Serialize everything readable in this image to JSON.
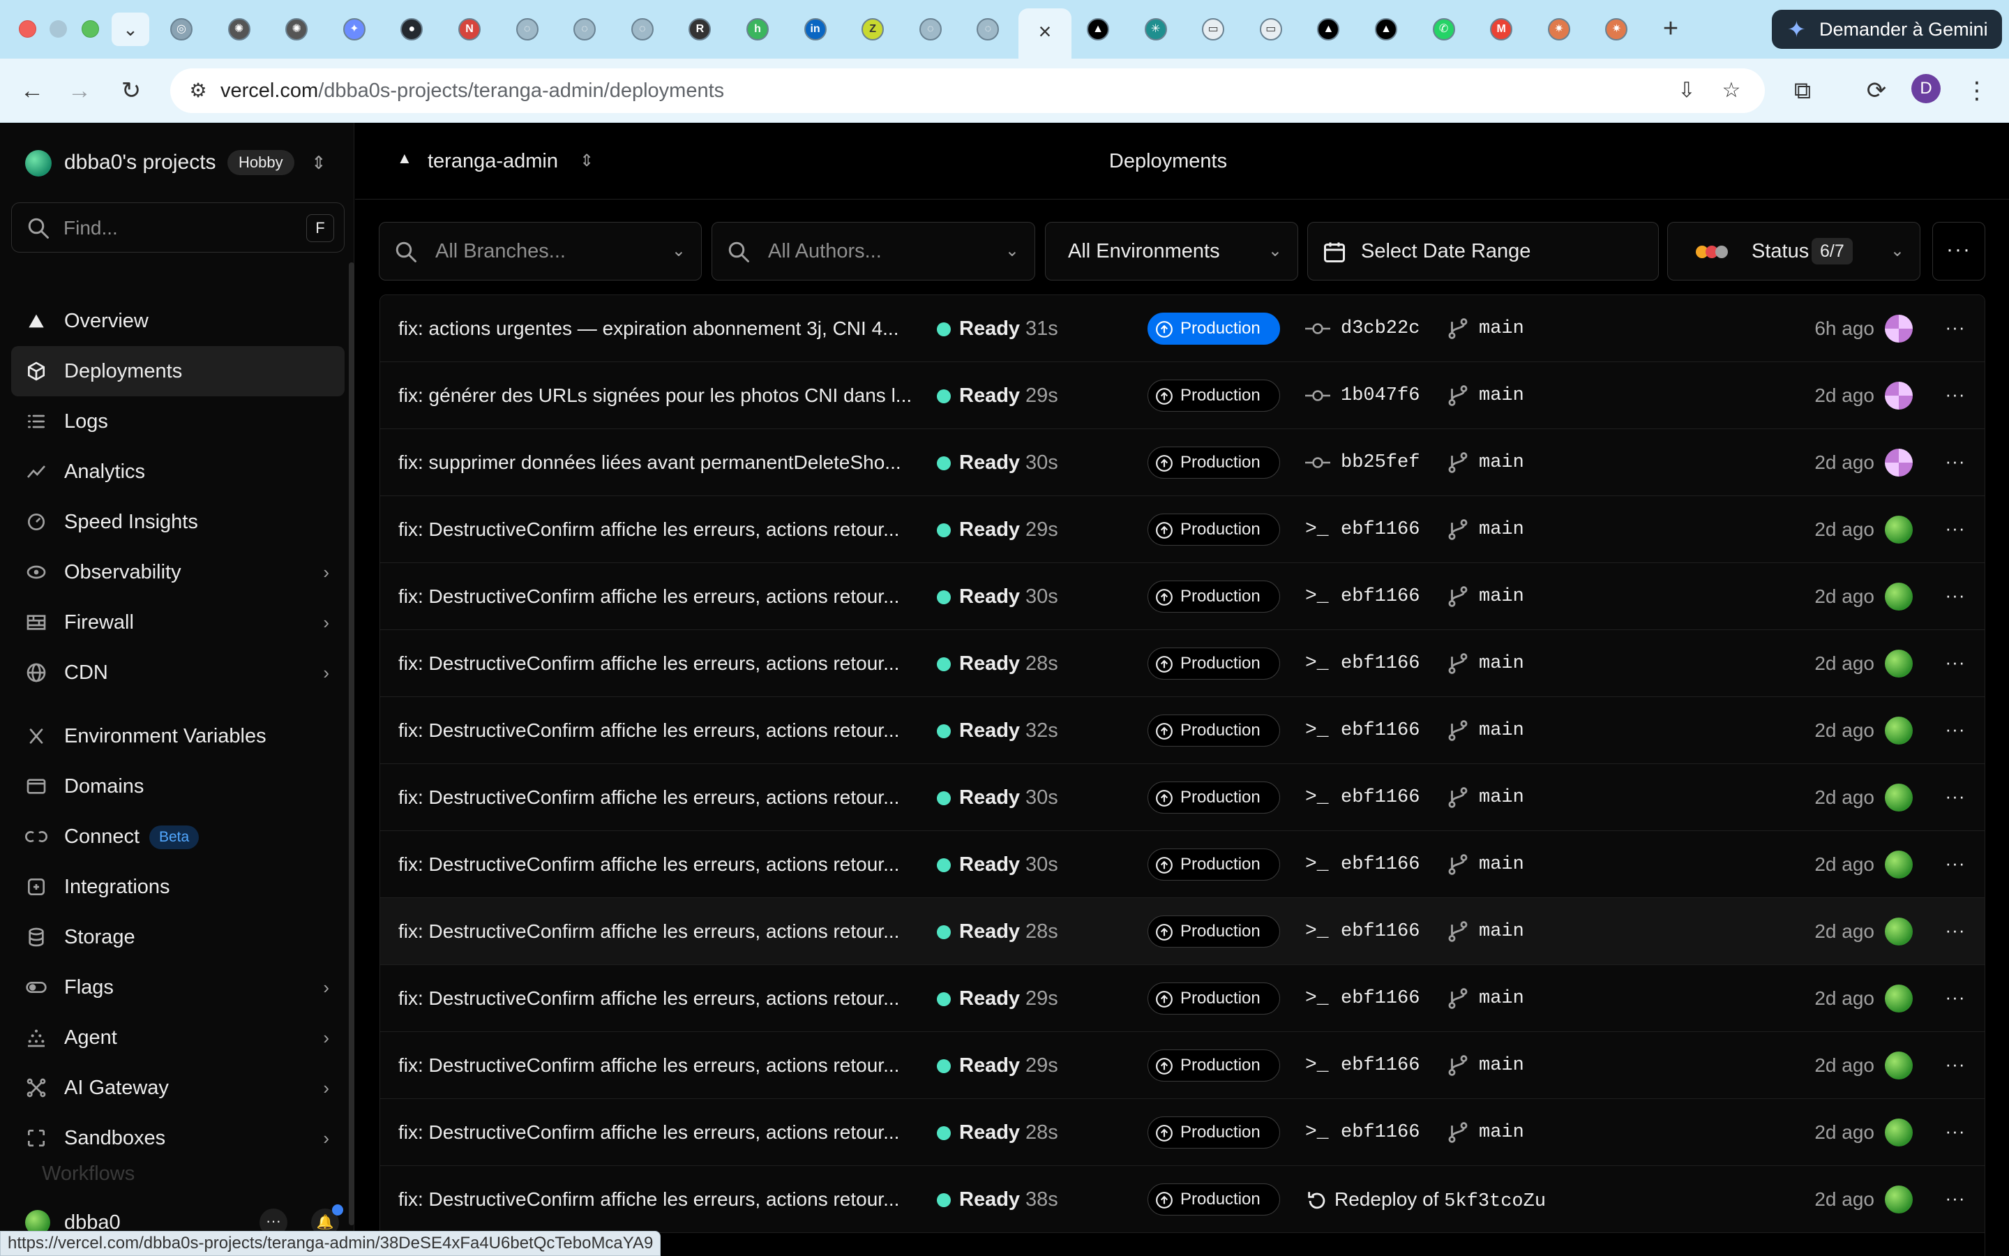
{
  "browser": {
    "pinned_tabs": [
      "chrome",
      "ai",
      "ai",
      "gemini",
      "github",
      "n",
      "compass",
      "compass",
      "compass",
      "r",
      "h",
      "linkedin",
      "z",
      "compass",
      "compass"
    ],
    "right_tabs": [
      "vercel",
      "perplexity",
      "doc",
      "doc",
      "vercel",
      "vercel",
      "whatsapp",
      "gmail",
      "claude",
      "claude"
    ],
    "gemini_label": "Demander à Gemini",
    "url_domain": "vercel.com",
    "url_path": "/dbba0s-projects/teranga-admin/deployments",
    "profile_initial": "D",
    "status_url": "https://vercel.com/dbba0s-projects/teranga-admin/38DeSE4xFa4U6betQcTeboMcaYA9"
  },
  "sidebar": {
    "team_name": "dbba0's projects",
    "plan_badge": "Hobby",
    "find_placeholder": "Find...",
    "find_shortcut": "F",
    "items": [
      {
        "label": "Overview",
        "icon": "triangle-icon",
        "chevron": false
      },
      {
        "label": "Deployments",
        "icon": "cube-icon",
        "chevron": false,
        "active": true
      },
      {
        "label": "Logs",
        "icon": "logs-icon",
        "chevron": false
      },
      {
        "label": "Analytics",
        "icon": "chart-icon",
        "chevron": false
      },
      {
        "label": "Speed Insights",
        "icon": "gauge-icon",
        "chevron": false
      },
      {
        "label": "Observability",
        "icon": "eye-icon",
        "chevron": true
      },
      {
        "label": "Firewall",
        "icon": "firewall-icon",
        "chevron": true
      },
      {
        "label": "CDN",
        "icon": "globe-icon",
        "chevron": true
      },
      {
        "label": "Environment Variables",
        "icon": "variable-icon",
        "chevron": false
      },
      {
        "label": "Domains",
        "icon": "domains-icon",
        "chevron": false
      },
      {
        "label": "Connect",
        "icon": "connect-icon",
        "chevron": false,
        "badge": "Beta"
      },
      {
        "label": "Integrations",
        "icon": "integrations-icon",
        "chevron": false
      },
      {
        "label": "Storage",
        "icon": "database-icon",
        "chevron": false
      },
      {
        "label": "Flags",
        "icon": "toggle-icon",
        "chevron": true
      },
      {
        "label": "Agent",
        "icon": "agent-icon",
        "chevron": true
      },
      {
        "label": "AI Gateway",
        "icon": "gateway-icon",
        "chevron": true
      },
      {
        "label": "Sandboxes",
        "icon": "sandbox-icon",
        "chevron": true
      }
    ],
    "faded_item": "Workflows",
    "user_name": "dbba0"
  },
  "header": {
    "project_name": "teranga-admin",
    "page_title": "Deployments"
  },
  "filters": {
    "branches_placeholder": "All Branches...",
    "authors_placeholder": "All Authors...",
    "environment_value": "All Environments",
    "date_value": "Select Date Range",
    "status_label": "Status",
    "status_count": "6/7",
    "status_colors": [
      "#f5a524",
      "#e5484d",
      "#a1a1a1"
    ]
  },
  "deployments": [
    {
      "message": "fix: actions urgentes — expiration abonnement 3j, CNI 4...",
      "status": "Ready",
      "duration": "31s",
      "env": "Production",
      "current": true,
      "source": "commit",
      "commit": "d3cb22c",
      "branch": "main",
      "age": "6h ago",
      "avatar": "pink"
    },
    {
      "message": "fix: générer des URLs signées pour les photos CNI dans l...",
      "status": "Ready",
      "duration": "29s",
      "env": "Production",
      "current": false,
      "source": "commit",
      "commit": "1b047f6",
      "branch": "main",
      "age": "2d ago",
      "avatar": "pink"
    },
    {
      "message": "fix: supprimer données liées avant permanentDeleteSho...",
      "status": "Ready",
      "duration": "30s",
      "env": "Production",
      "current": false,
      "source": "commit",
      "commit": "bb25fef",
      "branch": "main",
      "age": "2d ago",
      "avatar": "pink"
    },
    {
      "message": "fix: DestructiveConfirm affiche les erreurs, actions retour...",
      "status": "Ready",
      "duration": "29s",
      "env": "Production",
      "current": false,
      "source": "cli",
      "commit": "ebf1166",
      "branch": "main",
      "age": "2d ago",
      "avatar": "green"
    },
    {
      "message": "fix: DestructiveConfirm affiche les erreurs, actions retour...",
      "status": "Ready",
      "duration": "30s",
      "env": "Production",
      "current": false,
      "source": "cli",
      "commit": "ebf1166",
      "branch": "main",
      "age": "2d ago",
      "avatar": "green"
    },
    {
      "message": "fix: DestructiveConfirm affiche les erreurs, actions retour...",
      "status": "Ready",
      "duration": "28s",
      "env": "Production",
      "current": false,
      "source": "cli",
      "commit": "ebf1166",
      "branch": "main",
      "age": "2d ago",
      "avatar": "green"
    },
    {
      "message": "fix: DestructiveConfirm affiche les erreurs, actions retour...",
      "status": "Ready",
      "duration": "32s",
      "env": "Production",
      "current": false,
      "source": "cli",
      "commit": "ebf1166",
      "branch": "main",
      "age": "2d ago",
      "avatar": "green"
    },
    {
      "message": "fix: DestructiveConfirm affiche les erreurs, actions retour...",
      "status": "Ready",
      "duration": "30s",
      "env": "Production",
      "current": false,
      "source": "cli",
      "commit": "ebf1166",
      "branch": "main",
      "age": "2d ago",
      "avatar": "green"
    },
    {
      "message": "fix: DestructiveConfirm affiche les erreurs, actions retour...",
      "status": "Ready",
      "duration": "30s",
      "env": "Production",
      "current": false,
      "source": "cli",
      "commit": "ebf1166",
      "branch": "main",
      "age": "2d ago",
      "avatar": "green"
    },
    {
      "message": "fix: DestructiveConfirm affiche les erreurs, actions retour...",
      "status": "Ready",
      "duration": "28s",
      "env": "Production",
      "current": false,
      "source": "cli",
      "commit": "ebf1166",
      "branch": "main",
      "age": "2d ago",
      "avatar": "green",
      "hover": true
    },
    {
      "message": "fix: DestructiveConfirm affiche les erreurs, actions retour...",
      "status": "Ready",
      "duration": "29s",
      "env": "Production",
      "current": false,
      "source": "cli",
      "commit": "ebf1166",
      "branch": "main",
      "age": "2d ago",
      "avatar": "green"
    },
    {
      "message": "fix: DestructiveConfirm affiche les erreurs, actions retour...",
      "status": "Ready",
      "duration": "29s",
      "env": "Production",
      "current": false,
      "source": "cli",
      "commit": "ebf1166",
      "branch": "main",
      "age": "2d ago",
      "avatar": "green"
    },
    {
      "message": "fix: DestructiveConfirm affiche les erreurs, actions retour...",
      "status": "Ready",
      "duration": "28s",
      "env": "Production",
      "current": false,
      "source": "cli",
      "commit": "ebf1166",
      "branch": "main",
      "age": "2d ago",
      "avatar": "green"
    },
    {
      "message": "fix: DestructiveConfirm affiche les erreurs, actions retour...",
      "status": "Ready",
      "duration": "38s",
      "env": "Production",
      "current": false,
      "source": "redeploy",
      "redeploy_label": "Redeploy of",
      "commit": "5kf3tcoZu",
      "age": "2d ago",
      "avatar": "green"
    }
  ]
}
